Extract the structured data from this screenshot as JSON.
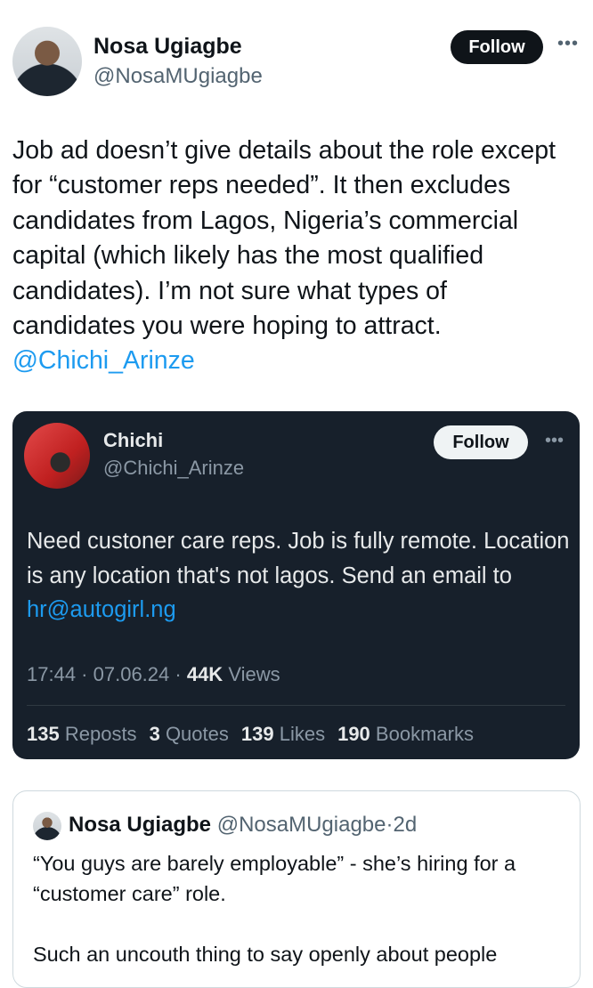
{
  "author": {
    "name": "Nosa Ugiagbe",
    "handle": "@NosaMUgiagbe",
    "follow_label": "Follow",
    "more_icon": "more-horizontal-icon"
  },
  "tweet": {
    "text": "Job ad doesn’t give details about the role except for “customer reps needed”. It then excludes candidates from Lagos, Nigeria’s commercial capital (which likely has the most qualified candidates). I’m not sure what types of candidates you were hoping to attract.",
    "mention": "@Chichi_Arinze"
  },
  "quoted": {
    "name": "Chichi",
    "handle": "@Chichi_Arinze",
    "follow_label": "Follow",
    "text": "Need custoner care reps. Job is fully remote. Location is any location that's not lagos. Send an email to",
    "email": "hr@autogirl.ng",
    "time": "17:44",
    "date": "07.06.24",
    "views_count": "44K",
    "views_label": "Views",
    "reposts_count": "135",
    "reposts_label": "Reposts",
    "quotes_count": "3",
    "quotes_label": "Quotes",
    "likes_count": "139",
    "likes_label": "Likes",
    "bookmarks_count": "190",
    "bookmarks_label": "Bookmarks"
  },
  "nested_quote": {
    "name": "Nosa Ugiagbe",
    "handle": "@NosaMUgiagbe",
    "age": "2d",
    "text": "“You guys are barely employable” - she’s hiring for a “customer care” role.\n\nSuch an uncouth thing to say openly about people"
  }
}
